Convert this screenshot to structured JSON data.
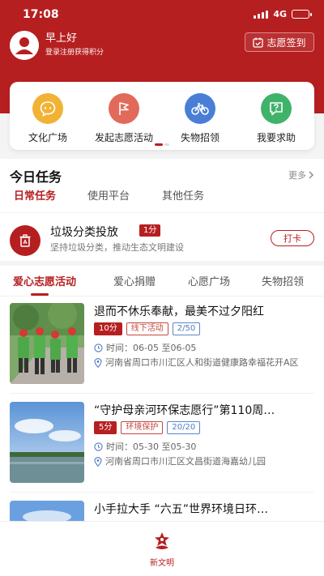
{
  "status_bar": {
    "time": "17:08",
    "network": "4G",
    "battery_level": 0.8
  },
  "header": {
    "greeting": "早上好",
    "login_hint": "登录注册获得积分",
    "checkin_label": "志愿签到"
  },
  "quick_actions": [
    {
      "label": "文化广场",
      "icon": "chat-bubble-icon",
      "color": "#f2b234"
    },
    {
      "label": "发起志愿活动",
      "icon": "flag-icon",
      "color": "#e26a5a"
    },
    {
      "label": "失物招领",
      "icon": "bike-icon",
      "color": "#4a7ed6"
    },
    {
      "label": "我要求助",
      "icon": "question-chat-icon",
      "color": "#3fb36a"
    }
  ],
  "colors": {
    "brand": "#b61f20",
    "page_bg": "#f4f4f4"
  },
  "today_tasks": {
    "title": "今日任务",
    "more_label": "更多",
    "tabs": [
      "日常任务",
      "使用平台",
      "其他任务"
    ],
    "active_tab": 0,
    "task": {
      "name": "垃圾分类投放",
      "points": "1分",
      "description": "坚持垃圾分类，推动生态文明建设",
      "action_label": "打卡"
    }
  },
  "activity_tabs": [
    "爱心志愿活动",
    "爱心捐赠",
    "心愿广场",
    "失物招领"
  ],
  "activity_active_tab": 0,
  "activities": [
    {
      "title": "退而不休乐奉献，最美不过夕阳红",
      "points": "10分",
      "type": "线下活动",
      "quota": "2/50",
      "time": "时间：06-05 至06-05",
      "address": "河南省周口市川汇区人和街道健康路幸福花开A区"
    },
    {
      "title": "“守护母亲河环保志愿行”第110周…",
      "points": "5分",
      "type": "环境保护",
      "quota": "20/20",
      "time": "时间：05-30 至05-30",
      "address": "河南省周口市川汇区文昌街道海嘉幼儿园"
    },
    {
      "title": "小手拉大手 “六五”世界环境日环…"
    }
  ],
  "bottom_tab": {
    "label": "新文明",
    "icon": "new-civilization-icon"
  }
}
